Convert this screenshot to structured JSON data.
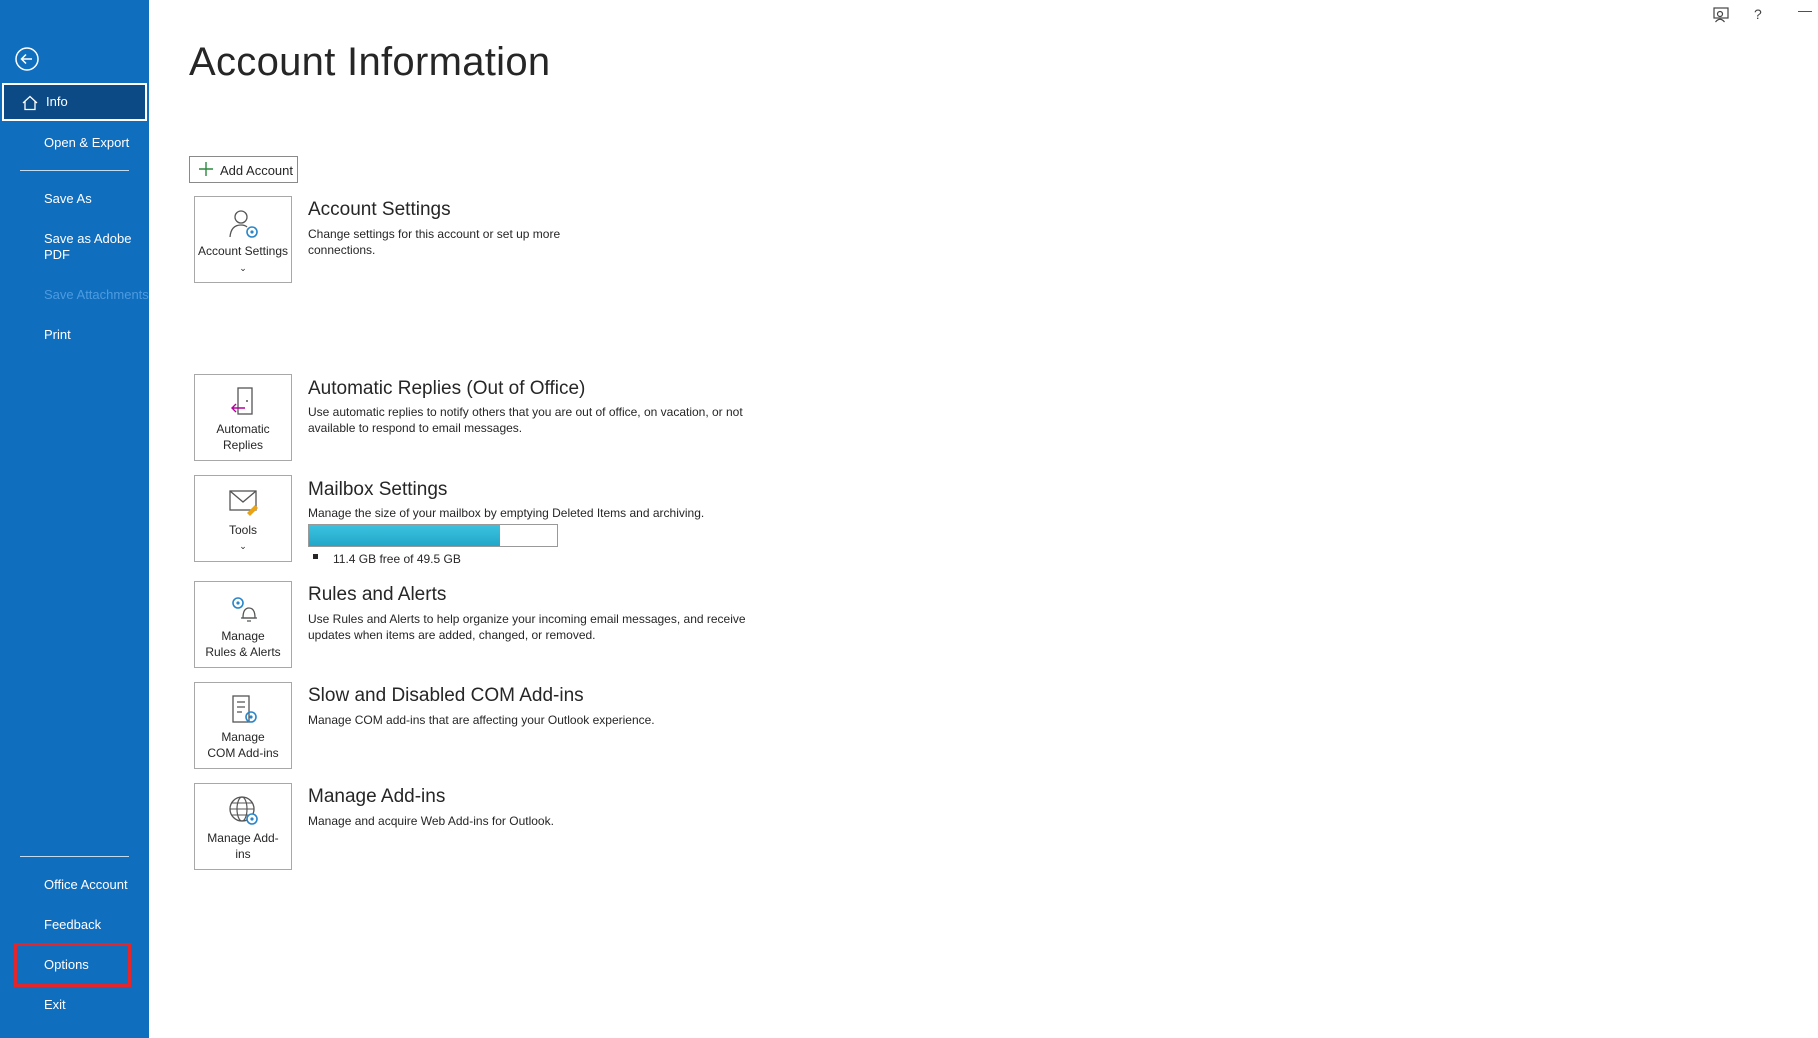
{
  "sidebar": {
    "items": [
      {
        "label": "Info"
      },
      {
        "label": "Open & Export"
      },
      {
        "label": "Save As"
      },
      {
        "label": "Save as Adobe PDF"
      },
      {
        "label": "Save Attachments"
      },
      {
        "label": "Print"
      },
      {
        "label": "Office Account"
      },
      {
        "label": "Feedback"
      },
      {
        "label": "Options"
      },
      {
        "label": "Exit"
      }
    ],
    "icons": {
      "back": "back-arrow-icon",
      "home": "home-icon"
    },
    "colors": {
      "background": "#106ebe",
      "active": "#0b4a84",
      "highlight": "#e3262b"
    }
  },
  "topbar": {
    "help": "?",
    "minimize": "—",
    "icons": [
      "feedback-person-icon",
      "help-icon",
      "minimize-icon"
    ]
  },
  "main": {
    "title": "Account Information",
    "add_account": "Add Account",
    "sections": [
      {
        "tile_label": "Account Settings",
        "tile_chevron": "⌄",
        "title": "Account Settings",
        "description": "Change settings for this account or set up more connections.",
        "icon": "account-settings-icon"
      },
      {
        "tile_label": "Automatic Replies",
        "title": "Automatic Replies (Out of Office)",
        "description": "Use automatic replies to notify others that you are out of office, on vacation, or not available to respond to email messages.",
        "icon": "automatic-replies-icon"
      },
      {
        "tile_label": "Tools",
        "tile_chevron": "⌄",
        "title": "Mailbox Settings",
        "description": "Manage the size of your mailbox by emptying Deleted Items and archiving.",
        "storage": "11.4 GB free of 49.5 GB",
        "used_fraction": 0.77,
        "icon": "mailbox-tools-icon"
      },
      {
        "tile_label": "Manage Rules & Alerts",
        "title": "Rules and Alerts",
        "description": "Use Rules and Alerts to help organize your incoming email messages, and receive updates when items are added, changed, or removed.",
        "icon": "rules-alerts-icon"
      },
      {
        "tile_label": "Manage COM Add-ins",
        "title": "Slow and Disabled COM Add-ins",
        "description": "Manage COM add-ins that are affecting your Outlook experience.",
        "icon": "com-addins-icon"
      },
      {
        "tile_label": "Manage Add-ins",
        "title": "Manage Add-ins",
        "description": "Manage and acquire Web Add-ins for Outlook.",
        "icon": "web-addins-icon"
      }
    ]
  }
}
